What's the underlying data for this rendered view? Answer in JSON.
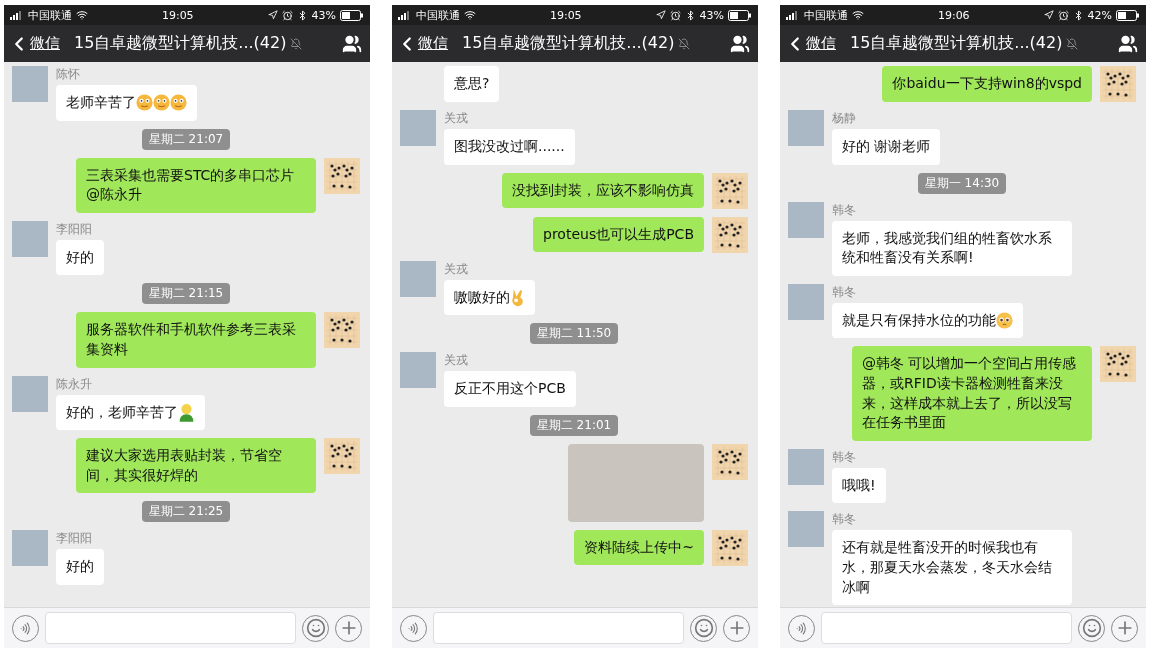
{
  "phones": [
    {
      "status_bar": {
        "carrier": "中国联通",
        "time": "19:05",
        "battery": "43%"
      },
      "nav": {
        "back": "微信",
        "title": "15自卓越微型计算机技...(42)"
      },
      "messages": [
        {
          "kind": "received",
          "sender": "陈怀",
          "text": "老师辛苦了",
          "emoji": [
            {
              "kind": "flushed"
            },
            {
              "kind": "flushed"
            },
            {
              "kind": "flushed"
            }
          ]
        },
        {
          "kind": "time",
          "text": "星期二 21:07"
        },
        {
          "kind": "sent",
          "text": "三表采集也需要STC的多串口芯片@陈永升"
        },
        {
          "kind": "received",
          "sender": "李阳阳",
          "text": "好的"
        },
        {
          "kind": "time",
          "text": "星期二 21:15"
        },
        {
          "kind": "sent",
          "text": "服务器软件和手机软件参考三表采集资料"
        },
        {
          "kind": "received",
          "sender": "陈永升",
          "text": "好的，老师辛苦了",
          "emoji": [
            {
              "kind": "figure"
            }
          ]
        },
        {
          "kind": "sent",
          "text": "建议大家选用表贴封装，节省空间，其实很好焊的"
        },
        {
          "kind": "time",
          "text": "星期二 21:25"
        },
        {
          "kind": "received",
          "sender": "李阳阳",
          "text": "好的"
        }
      ]
    },
    {
      "status_bar": {
        "carrier": "中国联通",
        "time": "19:05",
        "battery": "43%"
      },
      "nav": {
        "back": "微信",
        "title": "15自卓越微型计算机技...(42)"
      },
      "messages": [
        {
          "kind": "received",
          "text": "意思?"
        },
        {
          "kind": "received",
          "sender": "关戎",
          "text": "图我没改过啊......"
        },
        {
          "kind": "sent",
          "text": "没找到封装，应该不影响仿真"
        },
        {
          "kind": "sent",
          "text": "proteus也可以生成PCB"
        },
        {
          "kind": "received",
          "sender": "关戎",
          "text": "嗷嗷好的",
          "emoji": [
            {
              "kind": "ok-hand"
            }
          ]
        },
        {
          "kind": "time",
          "text": "星期二 11:50"
        },
        {
          "kind": "received",
          "sender": "关戎",
          "text": "反正不用这个PCB"
        },
        {
          "kind": "time",
          "text": "星期二 21:01"
        },
        {
          "kind": "image"
        },
        {
          "kind": "sent",
          "text": "资料陆续上传中~"
        }
      ]
    },
    {
      "status_bar": {
        "carrier": "中国联通",
        "time": "19:06",
        "battery": "42%"
      },
      "nav": {
        "back": "微信",
        "title": "15自卓越微型计算机技...(42)"
      },
      "messages": [
        {
          "kind": "sent",
          "text": "你baidu一下支持win8的vspd"
        },
        {
          "kind": "received",
          "sender": "杨静",
          "text": "好的 谢谢老师"
        },
        {
          "kind": "time",
          "text": "星期一 14:30"
        },
        {
          "kind": "received",
          "sender": "韩冬",
          "text": "老师，我感觉我们组的牲畜饮水系统和牲畜没有关系啊!"
        },
        {
          "kind": "received",
          "sender": "韩冬",
          "text": "就是只有保持水位的功能",
          "emoji": [
            {
              "kind": "pleading"
            }
          ]
        },
        {
          "kind": "sent",
          "text": "@韩冬 可以增加一个空间占用传感器，或RFID读卡器检测牲畜来没来，这样成本就上去了，所以没写在任务书里面"
        },
        {
          "kind": "received",
          "sender": "韩冬",
          "text": "哦哦!"
        },
        {
          "kind": "received",
          "sender": "韩冬",
          "text": "还有就是牲畜没开的时候我也有水，那夏天水会蒸发，冬天水会结冰啊"
        }
      ]
    }
  ]
}
